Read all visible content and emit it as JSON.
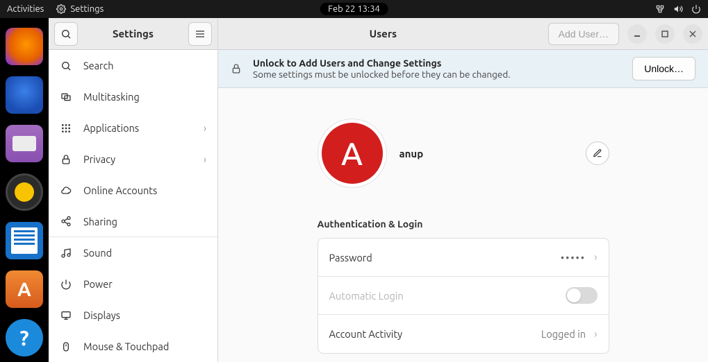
{
  "topbar": {
    "activities": "Activities",
    "app_name": "Settings",
    "clock": "Feb 22  13:34"
  },
  "settings_sidebar": {
    "title": "Settings",
    "items": [
      "Search",
      "Multitasking",
      "Applications",
      "Privacy",
      "Online Accounts",
      "Sharing",
      "Sound",
      "Power",
      "Displays",
      "Mouse & Touchpad"
    ]
  },
  "main": {
    "title": "Users",
    "add_user": "Add User…"
  },
  "banner": {
    "title": "Unlock to Add Users and Change Settings",
    "sub": "Some settings must be unlocked before they can be changed.",
    "button": "Unlock…"
  },
  "user": {
    "initial": "A",
    "name": "anup"
  },
  "auth": {
    "section": "Authentication & Login",
    "password_label": "Password",
    "password_dots": "•••••",
    "autologin_label": "Automatic Login",
    "autologin_on": false,
    "activity_label": "Account Activity",
    "activity_value": "Logged in"
  }
}
